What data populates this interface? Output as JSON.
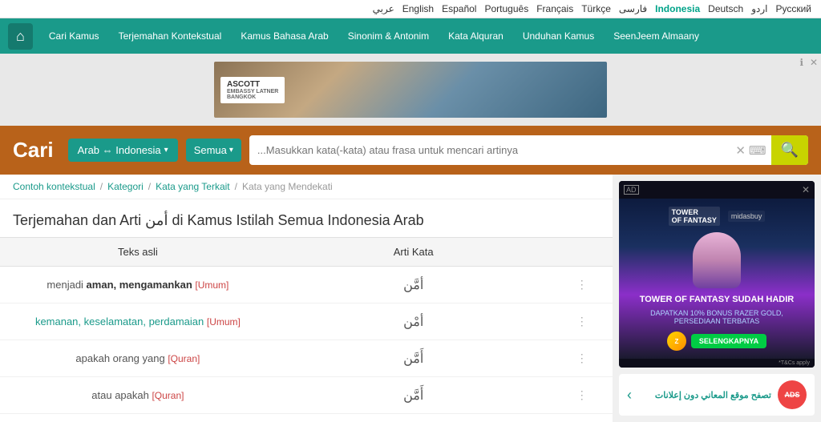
{
  "lang_bar": {
    "languages": [
      {
        "label": "عربي",
        "active": false
      },
      {
        "label": "English",
        "active": false
      },
      {
        "label": "Español",
        "active": false
      },
      {
        "label": "Português",
        "active": false
      },
      {
        "label": "Français",
        "active": false
      },
      {
        "label": "Türkçe",
        "active": false
      },
      {
        "label": "فارسی",
        "active": false
      },
      {
        "label": "Indonesia",
        "active": true
      },
      {
        "label": "Deutsch",
        "active": false
      },
      {
        "label": "اردو",
        "active": false
      },
      {
        "label": "Русский",
        "active": false
      }
    ]
  },
  "nav": {
    "items": [
      {
        "label": "Cari Kamus"
      },
      {
        "label": "Terjemahan Kontekstual"
      },
      {
        "label": "Kamus Bahasa Arab"
      },
      {
        "label": "Sinonim & Antonim"
      },
      {
        "label": "Kata Alquran"
      },
      {
        "label": "Unduhan Kamus"
      },
      {
        "label": "SeenJeem Almaany"
      }
    ]
  },
  "search": {
    "title": "Cari",
    "lang_btn": "Arab ⇔ Indonesia",
    "all_btn": "Semua",
    "placeholder": "...Masukkan kata(-kata) atau frasa untuk mencari artinya"
  },
  "breadcrumb": {
    "items": [
      {
        "label": "Contoh kontekstual"
      },
      {
        "label": "Kategori"
      },
      {
        "label": "Kata yang Terkait"
      },
      {
        "label": "Kata yang Mendekati",
        "active": true
      }
    ]
  },
  "page": {
    "title": "Terjemahan dan Arti أمن di Kamus Istilah Semua Indonesia Arab"
  },
  "table": {
    "col_source": "Teks asli",
    "col_translation": "Arti Kata",
    "rows": [
      {
        "source_parts": [
          {
            "text": "menjadi ",
            "type": "normal"
          },
          {
            "text": "aman, mengamankan",
            "type": "bold"
          },
          {
            "text": " [Umum]",
            "type": "tag"
          }
        ],
        "translation": "أمَّن",
        "source_display": "menjadi aman, mengamankan [Umum]"
      },
      {
        "source_parts": [
          {
            "text": "kemanan, keselamatan, perdamaian",
            "type": "link"
          },
          {
            "text": " [Umum]",
            "type": "tag"
          }
        ],
        "translation": "أمْن",
        "source_display": "kemanan, keselamatan, perdamaian [Umum]"
      },
      {
        "source_parts": [
          {
            "text": "apakah orang yang ",
            "type": "normal"
          },
          {
            "text": "[Quran]",
            "type": "tag-quran"
          }
        ],
        "translation": "أَمَّن",
        "source_display": "apakah orang yang [Quran]"
      },
      {
        "source_parts": [
          {
            "text": "atau apakah ",
            "type": "normal"
          },
          {
            "text": "[Quran]",
            "type": "tag-quran"
          }
        ],
        "translation": "أَمَّن",
        "source_display": "atau apakah [Quran]"
      }
    ]
  },
  "sidebar": {
    "ad": {
      "title": "TOWER OF FANTASY SUDAH HADIR",
      "subtitle": "DAPATKAN 10% BONUS RAZER GOLD, PERSEDIAAN TERBATAS",
      "btn_label": "SELENGKAPNYA",
      "tc_label": "*T&Cs apply",
      "logos": [
        "TOWER OF FANTASY",
        "midasbuy"
      ]
    },
    "anti_ad": {
      "text": "تصفح موقع المعاني دون إعلانات",
      "logo": "ADS"
    }
  }
}
